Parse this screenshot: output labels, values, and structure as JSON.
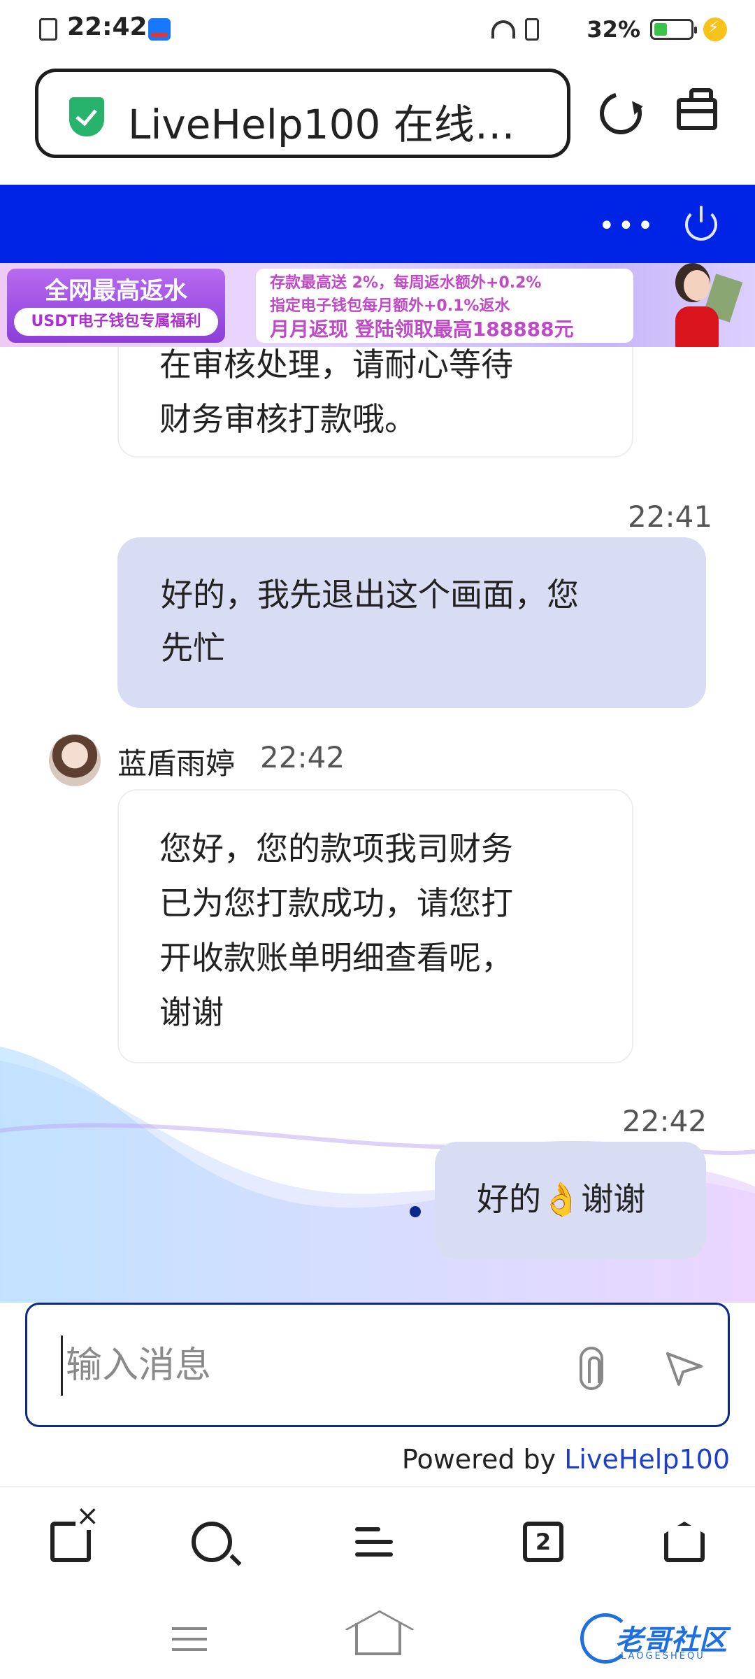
{
  "status_bar": {
    "time": "22:42",
    "battery_percent": "32%",
    "battery_level": 0.32,
    "icons": [
      "sim-icon",
      "alipay-icon",
      "headset-icon",
      "vibrate-icon",
      "wifi-icon",
      "battery-icon",
      "charging-icon"
    ]
  },
  "browser": {
    "url_title": "LiveHelp100 在线…",
    "icons": [
      "security-shield-icon",
      "reload-icon",
      "toolbox-icon"
    ]
  },
  "chat_header": {
    "background": "#0024e6",
    "more_label": "•••"
  },
  "banner": {
    "left_title": "全网最高返水",
    "left_sub": "USDT电子钱包专属福利",
    "line1": "存款最高送 2%，每周返水额外+0.2%",
    "line2": "指定电子钱包每月额外+0.1%返水",
    "line3": "月月返现 登陆领取最高188888元"
  },
  "messages": [
    {
      "direction": "in",
      "text_lines": [
        "在审核处理，请耐心等待",
        "财务审核打款哦。"
      ]
    },
    {
      "direction": "out",
      "time": "22:41",
      "text_lines": [
        "好的，我先退出这个画面，您",
        "先忙"
      ]
    },
    {
      "direction": "in",
      "sender": "蓝盾雨婷",
      "time": "22:42",
      "text_lines": [
        "您好，您的款项我司财务",
        "已为您打款成功，请您打",
        "开收款账单明细查看呢，",
        "谢谢"
      ]
    },
    {
      "direction": "out",
      "time": "22:42",
      "text": "好的👌谢谢"
    }
  ],
  "composer": {
    "placeholder": "输入消息",
    "value": ""
  },
  "powered_by": {
    "prefix": "Powered by ",
    "brand": "LiveHelp100"
  },
  "bottom_nav": {
    "tab_count": "2",
    "icons": [
      "close-tab-icon",
      "search-icon",
      "menu-add-icon",
      "tabs-icon",
      "home-icon"
    ]
  },
  "system_nav": {
    "icons": [
      "recent-apps-icon",
      "home-gesture-icon"
    ]
  },
  "watermark": {
    "title": "老哥社区",
    "sub": "LAOGESHEQU"
  },
  "colors": {
    "accent": "#0024e6",
    "bubble_out": "#d9ddf3",
    "brand_link": "#1b3fc9"
  }
}
